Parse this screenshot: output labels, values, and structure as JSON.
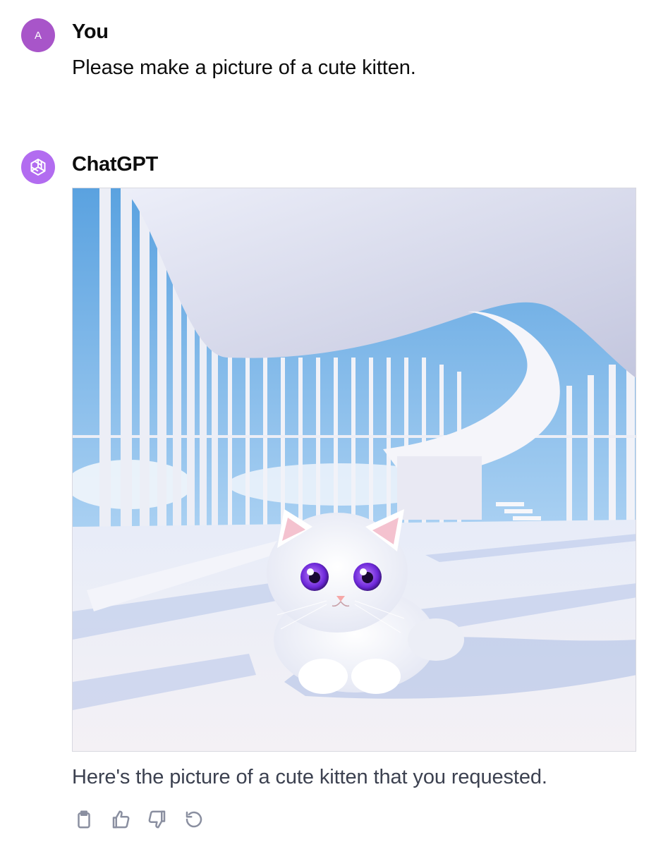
{
  "user_message": {
    "avatar_initial": "A",
    "author": "You",
    "text": "Please make a picture of a cute kitten."
  },
  "assistant_message": {
    "author": "ChatGPT",
    "avatar_icon": "openai-logo-icon",
    "image": {
      "description_icon": "generated-image"
    },
    "text": "Here's the picture of a cute kitten that you requested.",
    "actions": [
      "copy-icon",
      "thumbs-up-icon",
      "thumbs-down-icon",
      "regenerate-icon"
    ]
  },
  "colors": {
    "user_avatar": "#a855c9",
    "assistant_avatar": "#b26cf0",
    "action_icon": "#8a8fa0",
    "reply_text": "#3c4150"
  }
}
